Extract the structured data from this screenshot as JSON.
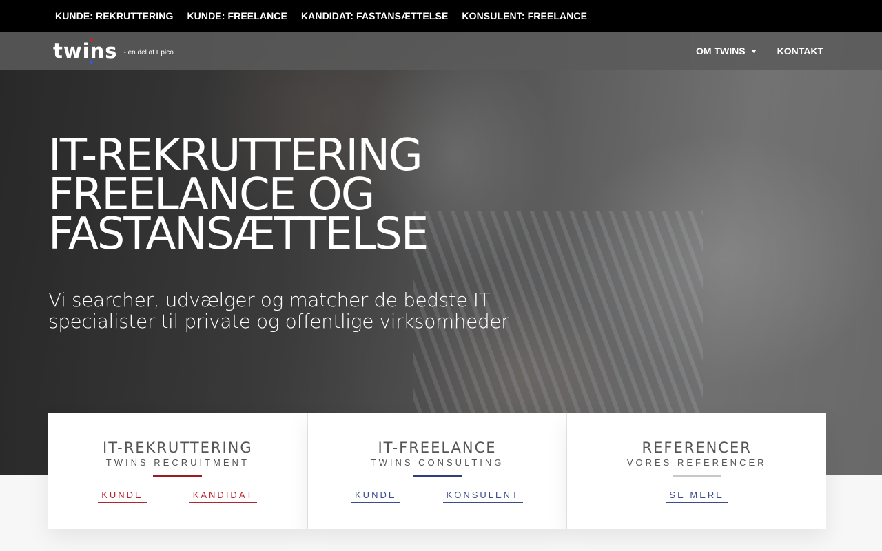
{
  "topbar": {
    "links": [
      {
        "label": "KUNDE: REKRUTTERING"
      },
      {
        "label": "KUNDE: FREELANCE"
      },
      {
        "label": "KANDIDAT: FASTANSÆTTELSE"
      },
      {
        "label": "KONSULENT: FREELANCE"
      }
    ]
  },
  "header": {
    "logo_text": "twins",
    "logo_tagline": "- en del af Epico",
    "nav": [
      {
        "label": "OM TWINS",
        "has_dropdown": true
      },
      {
        "label": "KONTAKT"
      }
    ]
  },
  "hero": {
    "title_lines": [
      "IT-REKRUTTERING",
      "FREELANCE OG",
      "FASTANSÆTTELSE"
    ],
    "subtitle": "Vi searcher, udvælger og matcher de bedste IT specialister til private og offentlige virksomheder"
  },
  "cards": [
    {
      "title": "IT-REKRUTTERING",
      "subtitle": "TWINS RECRUITMENT",
      "accent": "#9e1a22",
      "links": [
        {
          "label": "KUNDE"
        },
        {
          "label": "KANDIDAT"
        }
      ]
    },
    {
      "title": "IT-FREELANCE",
      "subtitle": "TWINS CONSULTING",
      "accent": "#2d3f7f",
      "links": [
        {
          "label": "KUNDE"
        },
        {
          "label": "KONSULENT"
        }
      ]
    },
    {
      "title": "REFERENCER",
      "subtitle": "VORES REFERENCER",
      "accent": "#c8c8c8",
      "links": [
        {
          "label": "SE MERE"
        }
      ]
    }
  ]
}
